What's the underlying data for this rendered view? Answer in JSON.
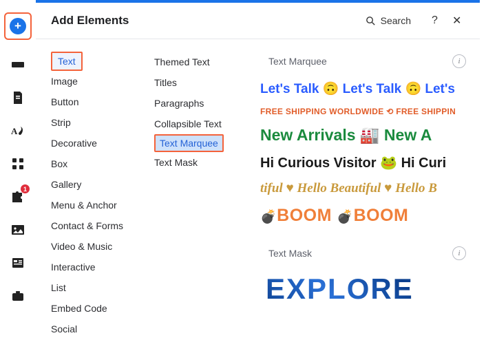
{
  "header": {
    "title": "Add Elements",
    "search_label": "Search",
    "help_glyph": "?",
    "close_glyph": "✕"
  },
  "leftbar": {
    "plus_glyph": "+",
    "puzzle_badge": "1"
  },
  "col1": {
    "items": [
      "Text",
      "Image",
      "Button",
      "Strip",
      "Decorative",
      "Box",
      "Gallery",
      "Menu & Anchor",
      "Contact & Forms",
      "Video & Music",
      "Interactive",
      "List",
      "Embed Code",
      "Social"
    ],
    "selected": "Text"
  },
  "col2": {
    "items": [
      "Themed Text",
      "Titles",
      "Paragraphs",
      "Collapsible Text",
      "Text Marquee",
      "Text Mask"
    ],
    "selected": "Text Marquee"
  },
  "sections": {
    "marquee": {
      "title": "Text Marquee"
    },
    "mask": {
      "title": "Text Mask"
    }
  },
  "streams": {
    "s1": "Let's Talk 🙃   Let's Talk 🙃   Let's",
    "s2": "FREE SHIPPING WORLDWIDE  ⟲   FREE SHIPPIN",
    "s3_a": "New Arrivals ",
    "s3_icon": "🏭",
    "s3_b": " New A",
    "s4_a": "Hi Curious Visitor  ",
    "s4_icon": "🐸",
    "s4_b": "   Hi Curi",
    "s5": "tiful ♥ Hello Beautiful ♥ Hello B",
    "s6_bomb": "💣",
    "s6_a": "BOOM",
    "s6_b": "BOOM",
    "explore": "EXPLORE"
  },
  "info_glyph": "i"
}
